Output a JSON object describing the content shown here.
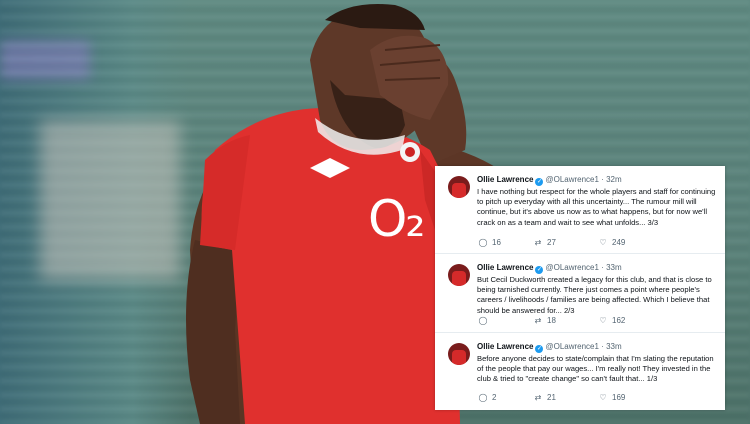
{
  "tweets": [
    {
      "name": "Ollie Lawrence",
      "handle": "@OLawrence1",
      "time": "· 32m",
      "text": "I have nothing but respect for the whole players and staff for continuing to pitch up everyday with all this uncertainty... The rumour mill will continue, but it's above us now as to what happens, but for now we'll crack on as a team and wait to see what unfolds... 3/3",
      "replies": "16",
      "retweets": "27",
      "likes": "249"
    },
    {
      "name": "Ollie Lawrence",
      "handle": "@OLawrence1",
      "time": "· 33m",
      "text": "But Cecil Duckworth created a legacy for this club, and that is close to being tarnished currently. There just comes a point where people's careers / livelihoods / families are being affected. Which I believe that should be answered for... 2/3",
      "replies": "",
      "retweets": "18",
      "likes": "162"
    },
    {
      "name": "Ollie Lawrence",
      "handle": "@OLawrence1",
      "time": "· 33m",
      "text": "Before anyone decides to state/complain that I'm slating the reputation of the people that pay our wages... I'm really not! They invested in the club & tried to \"create change\" so can't fault that... 1/3",
      "replies": "2",
      "retweets": "21",
      "likes": "169"
    }
  ],
  "shirt": {
    "sponsor_logo": "O₂"
  },
  "icons": {
    "reply": "reply-icon",
    "retweet": "retweet-icon",
    "like": "like-icon",
    "verified": "verified-badge-icon"
  },
  "colors": {
    "shirt_red": "#e0302e",
    "pitch_green": "#5a827a",
    "twitter_blue": "#1d9bf0"
  }
}
